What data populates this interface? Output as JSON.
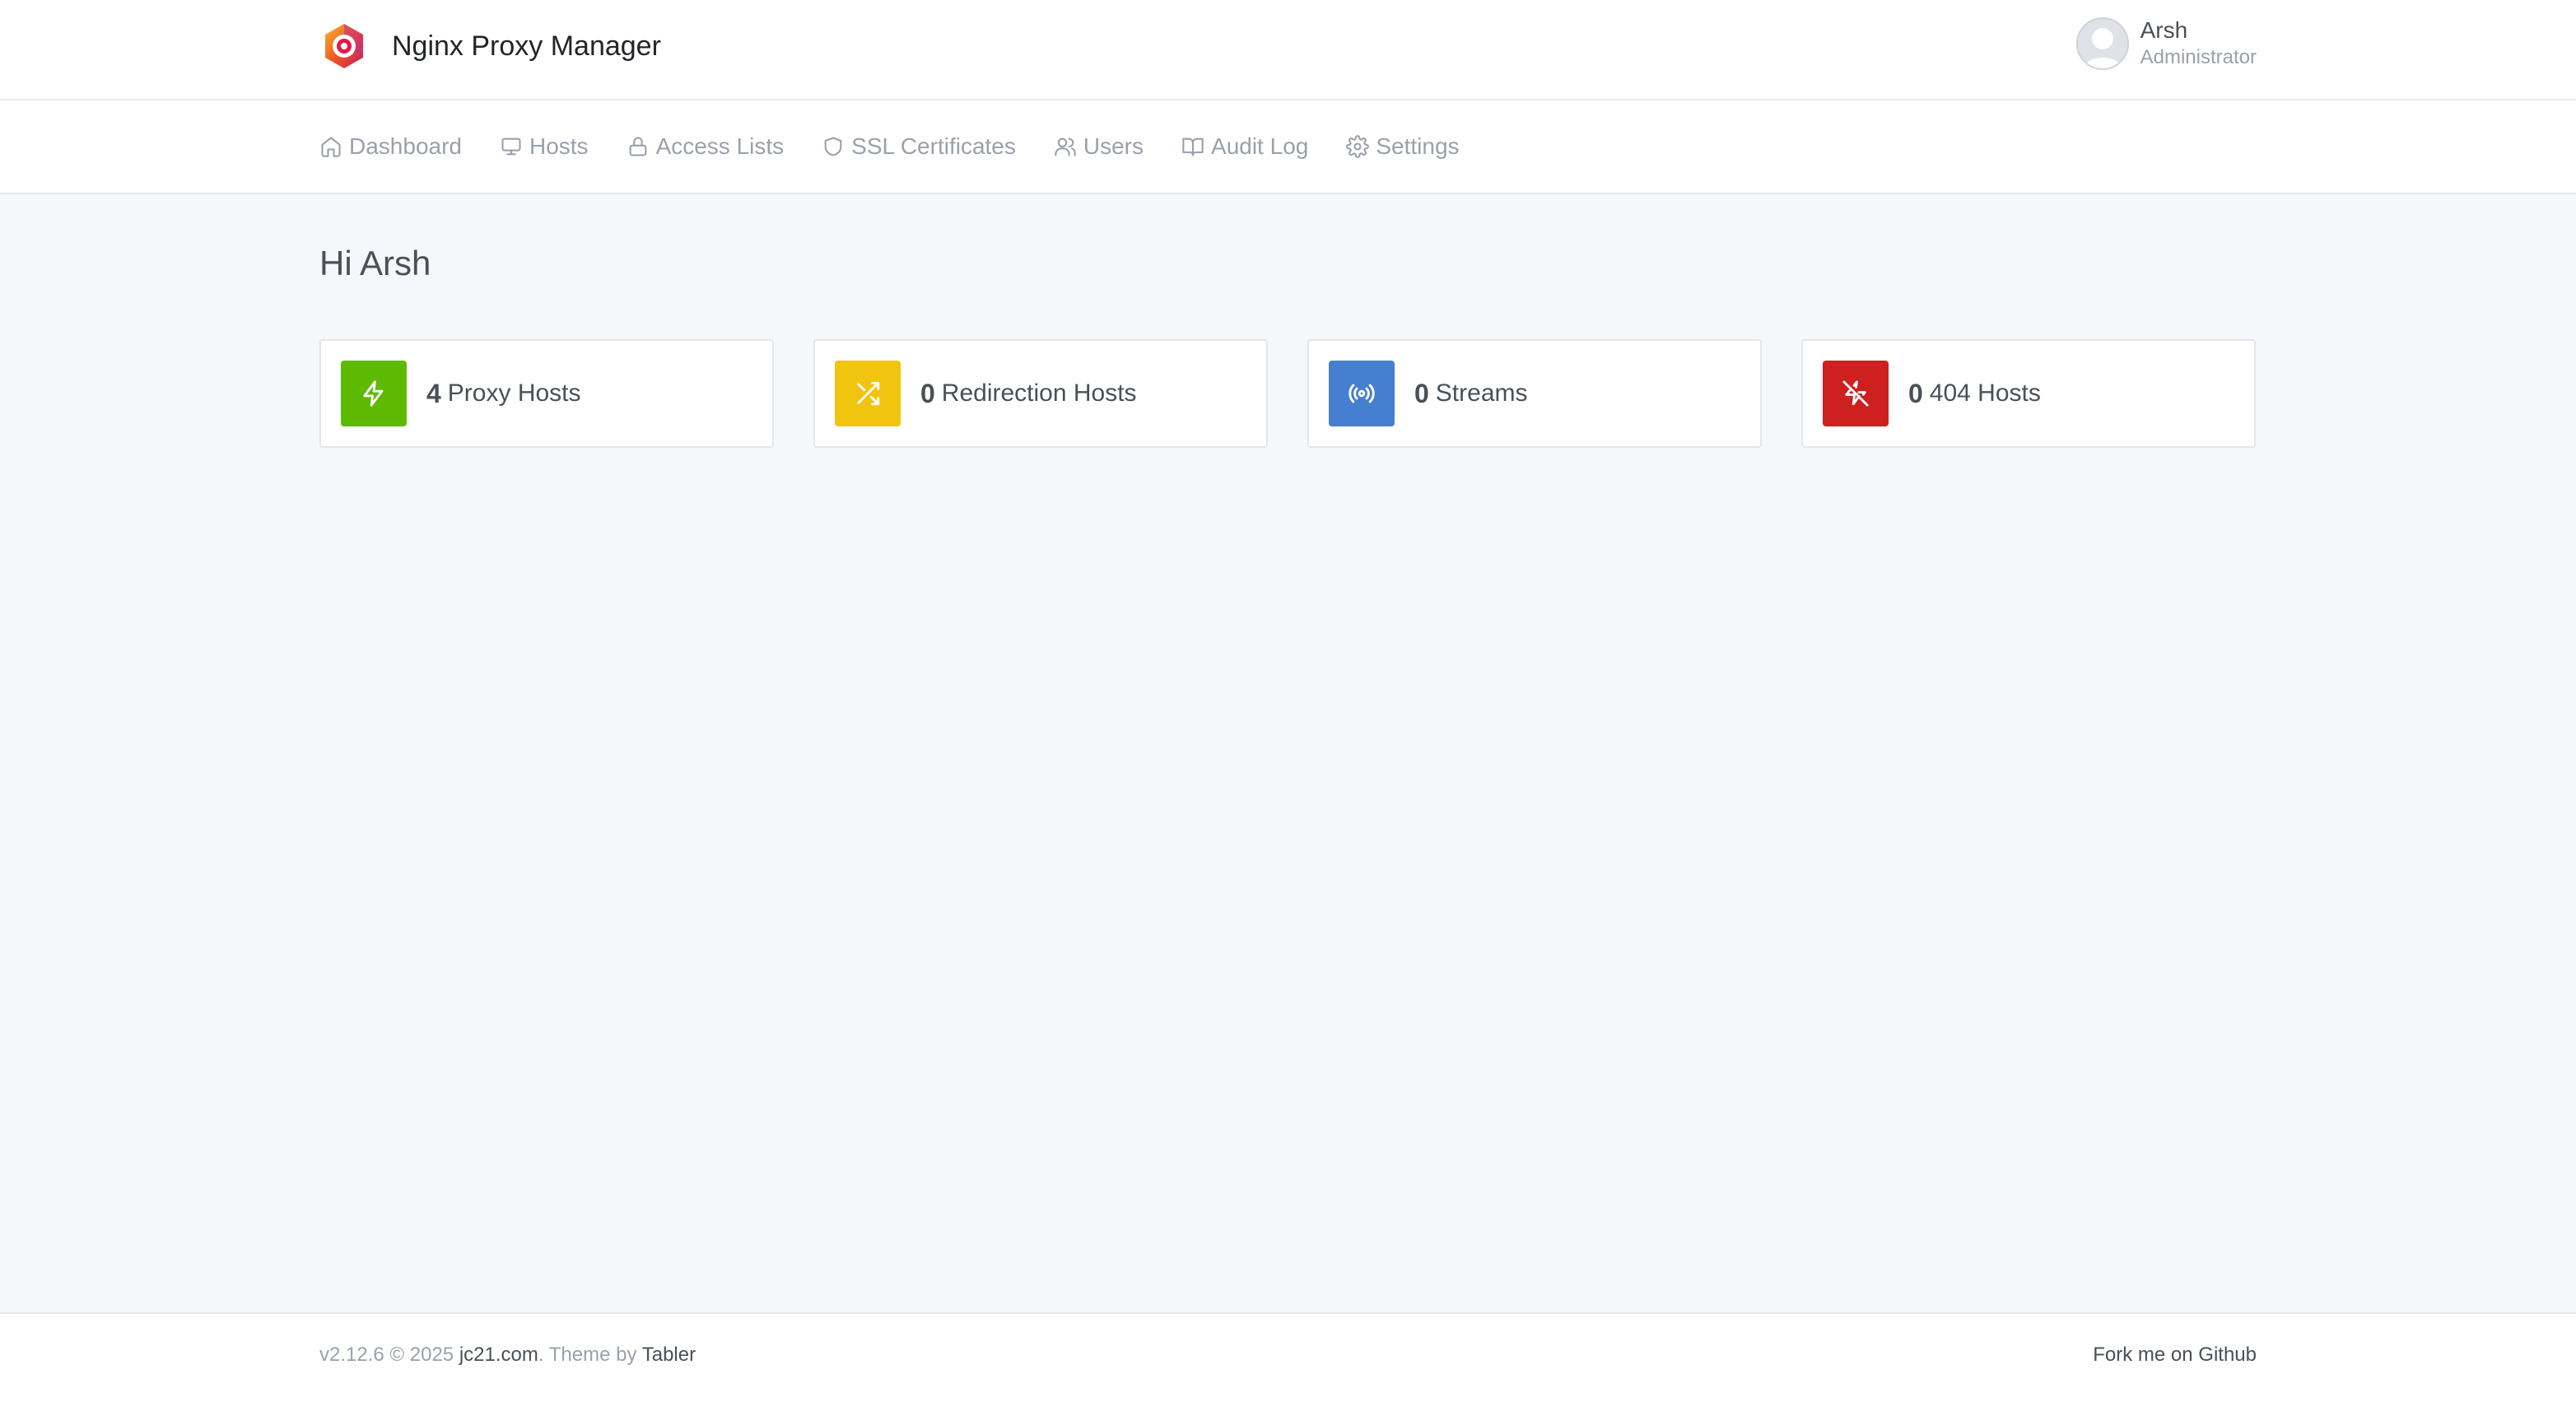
{
  "header": {
    "app_title": "Nginx Proxy Manager",
    "logo_icon": "nginx-proxy-manager-logo",
    "user": {
      "name": "Arsh",
      "role": "Administrator",
      "avatar_icon": "avatar-placeholder"
    }
  },
  "nav": {
    "items": [
      {
        "label": "Dashboard",
        "icon": "home-icon"
      },
      {
        "label": "Hosts",
        "icon": "monitor-icon"
      },
      {
        "label": "Access Lists",
        "icon": "lock-icon"
      },
      {
        "label": "SSL Certificates",
        "icon": "shield-icon"
      },
      {
        "label": "Users",
        "icon": "users-icon"
      },
      {
        "label": "Audit Log",
        "icon": "book-icon"
      },
      {
        "label": "Settings",
        "icon": "gear-icon"
      }
    ]
  },
  "main": {
    "greeting": "Hi Arsh",
    "cards": [
      {
        "count": "4",
        "label": "Proxy Hosts",
        "icon": "zap-icon",
        "color": "#5eba00"
      },
      {
        "count": "0",
        "label": "Redirection Hosts",
        "icon": "shuffle-icon",
        "color": "#f1c40f"
      },
      {
        "count": "0",
        "label": "Streams",
        "icon": "radio-icon",
        "color": "#467fcf"
      },
      {
        "count": "0",
        "label": "404 Hosts",
        "icon": "zap-off-icon",
        "color": "#cd201f"
      }
    ]
  },
  "footer": {
    "version_text": "v2.12.6 © 2025 ",
    "company_link": "jc21.com",
    "theme_text": ". Theme by ",
    "theme_link": "Tabler",
    "github_link": "Fork me on Github"
  }
}
